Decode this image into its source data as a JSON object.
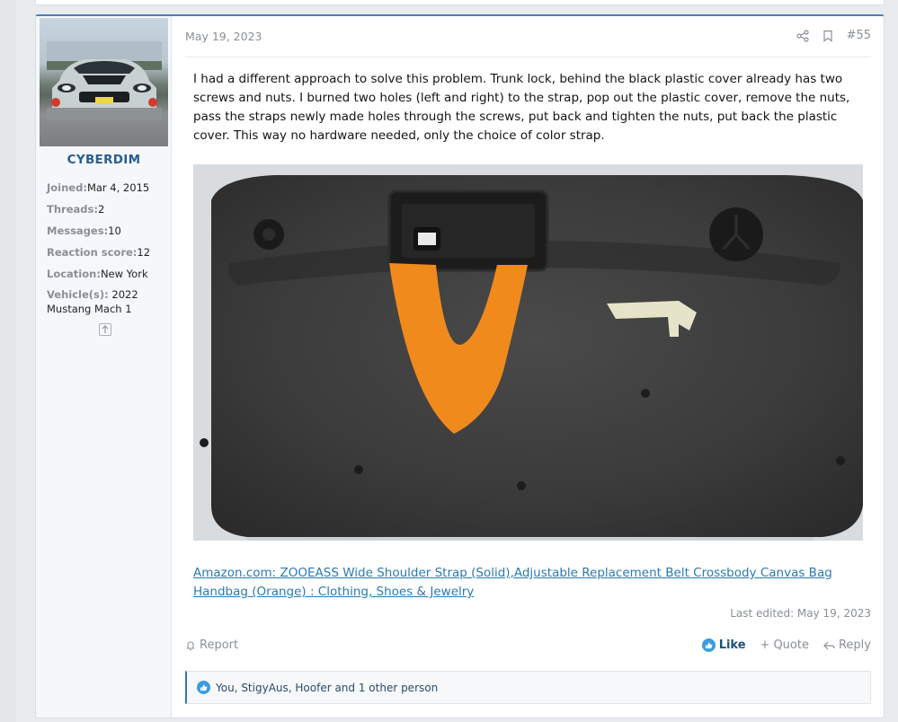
{
  "user": {
    "username": "CYBERDIM",
    "stats": [
      {
        "label": "Joined:",
        "value": "Mar 4, 2015"
      },
      {
        "label": "Threads:",
        "value": "2"
      },
      {
        "label": "Messages:",
        "value": "10"
      },
      {
        "label": "Reaction score:",
        "value": "12"
      },
      {
        "label": "Location:",
        "value": "New York"
      }
    ],
    "vehicle_label": "Vehicle(s):",
    "vehicle_value": "2022 Mustang Mach 1",
    "expand_icon": "expand-up-icon"
  },
  "post": {
    "date": "May 19, 2023",
    "number": "#55",
    "body": "I had a different approach to solve this problem. Trunk lock, behind the black plastic cover already has two screws and nuts. I burned two holes (left and right) to the strap, pop out the plastic cover, remove the nuts, pass the straps newly made holes through the screws, put back and tighten the nuts, put back the plastic cover. This way no hardware needed, only the choice of color strap.",
    "link_text": "Amazon.com: ZOOEASS Wide Shoulder Strap (Solid),Adjustable Replacement Belt Crossbody Canvas Bag Handbag (Orange) : Clothing, Shoes & Jewelry",
    "last_edited": "Last edited: May 19, 2023"
  },
  "actions": {
    "report": "Report",
    "like": "Like",
    "quote": "Quote",
    "reply": "Reply"
  },
  "reactions": {
    "text": "You, StigyAus, Hoofer and 1 other person"
  },
  "colors": {
    "accent": "#2a5d8f",
    "link": "#2a7ab0",
    "like_blue": "#3b9be0",
    "strap_orange": "#f08a1c"
  }
}
